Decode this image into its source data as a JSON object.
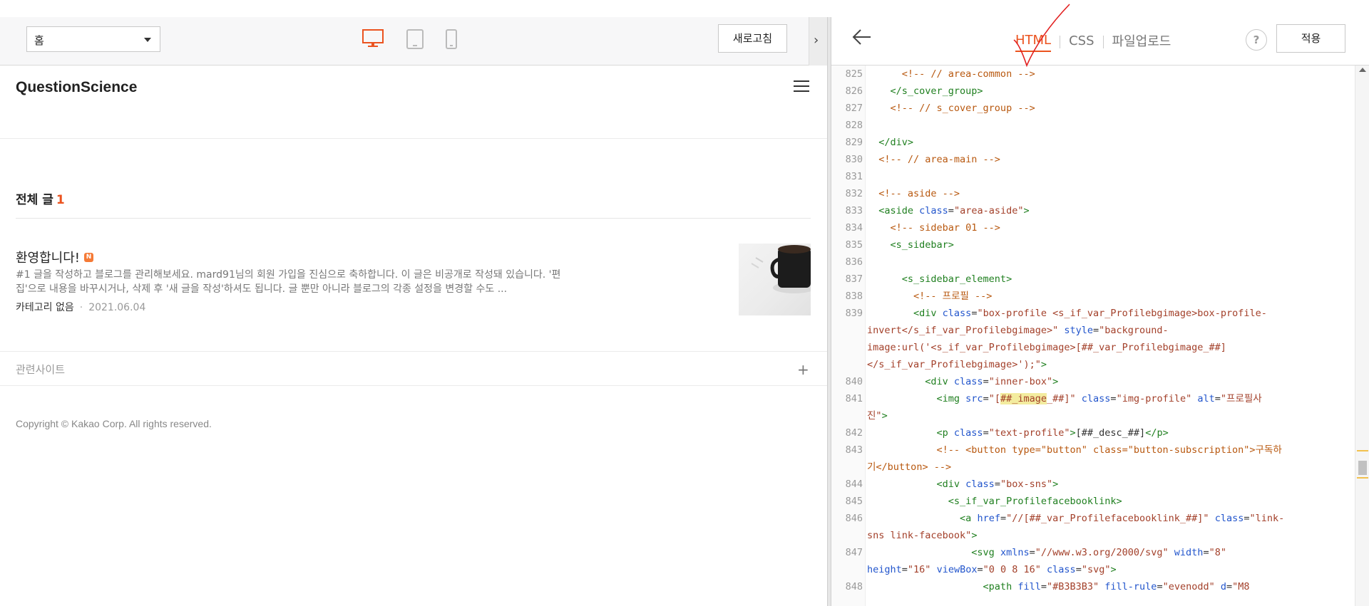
{
  "preview": {
    "page_select": {
      "value": "홈"
    },
    "refresh_label": "새로고침",
    "collapse_glyph": "›",
    "blog_title": "QuestionScience",
    "all_posts": {
      "label": "전체 글",
      "count": "1"
    },
    "post": {
      "title": "환영합니다!",
      "badge": "N",
      "excerpt": "#1 글을 작성하고 블로그를 관리해보세요. mard91님의 회원 가입을 진심으로 축하합니다. 이 글은 비공개로 작성돼 있습니다. '편집'으로 내용을 바꾸시거나, 삭제 후 '새 글을 작성'하셔도 됩니다. 글 뿐만 아니라 블로그의 각종 설정을 변경할 수도 ...",
      "category": "카테고리 없음",
      "date": "2021.06.04"
    },
    "related_sites_label": "관련사이트",
    "copyright": "Copyright © Kakao Corp. All rights reserved."
  },
  "editor": {
    "tabs": [
      {
        "label": "HTML",
        "active": true
      },
      {
        "label": "CSS",
        "active": false
      },
      {
        "label": "파일업로드",
        "active": false
      }
    ],
    "help_label": "?",
    "apply_label": "적용",
    "accent_color": "#eb531f",
    "code_lines": [
      {
        "n": "825",
        "text": ""
      },
      {
        "n": "826",
        "text": ""
      },
      {
        "n": "827",
        "text": ""
      },
      {
        "n": "828",
        "text": ""
      },
      {
        "n": "829",
        "text": ""
      },
      {
        "n": "830",
        "text": ""
      },
      {
        "n": "831",
        "text": ""
      },
      {
        "n": "832",
        "text": ""
      },
      {
        "n": "833",
        "text": ""
      },
      {
        "n": "834",
        "text": ""
      },
      {
        "n": "835",
        "text": ""
      },
      {
        "n": "836",
        "text": ""
      },
      {
        "n": "837",
        "text": ""
      },
      {
        "n": "838",
        "text": ""
      },
      {
        "n": "839",
        "text": ""
      },
      {
        "n": "840",
        "text": ""
      },
      {
        "n": "841",
        "text": ""
      },
      {
        "n": "842",
        "text": ""
      },
      {
        "n": "843",
        "text": ""
      },
      {
        "n": "844",
        "text": ""
      },
      {
        "n": "845",
        "text": ""
      },
      {
        "n": "846",
        "text": ""
      },
      {
        "n": "847",
        "text": ""
      },
      {
        "n": "848",
        "text": ""
      }
    ],
    "code_text": [
      {
        "spans": [
          [
            "c-comment",
            "      <!-- // area-common -->"
          ]
        ]
      },
      {
        "spans": [
          [
            "c-tag",
            "    </s_cover_group>"
          ]
        ]
      },
      {
        "spans": [
          [
            "c-comment",
            "    <!-- // s_cover_group -->"
          ]
        ]
      },
      {
        "spans": []
      },
      {
        "spans": [
          [
            "c-tag",
            "  </div>"
          ]
        ]
      },
      {
        "spans": [
          [
            "c-comment",
            "  <!-- // area-main -->"
          ]
        ]
      },
      {
        "spans": []
      },
      {
        "spans": [
          [
            "c-comment",
            "  <!-- aside -->"
          ]
        ]
      },
      {
        "spans": [
          [
            "c-tag",
            "  <aside "
          ],
          [
            "c-attr",
            "class"
          ],
          [
            "c-plain",
            "="
          ],
          [
            "c-str",
            "\"area-aside\""
          ],
          [
            "c-tag",
            ">"
          ]
        ]
      },
      {
        "spans": [
          [
            "c-comment",
            "    <!-- sidebar 01 -->"
          ]
        ]
      },
      {
        "spans": [
          [
            "c-tag",
            "    <s_sidebar>"
          ]
        ]
      },
      {
        "spans": []
      },
      {
        "spans": [
          [
            "c-tag",
            "      <s_sidebar_element>"
          ]
        ]
      },
      {
        "spans": [
          [
            "c-comment",
            "        <!-- 프로필 -->"
          ]
        ]
      },
      {
        "spans": [
          [
            "c-tag",
            "        <div "
          ],
          [
            "c-attr",
            "class"
          ],
          [
            "c-plain",
            "="
          ],
          [
            "c-str",
            "\"box-profile <s_if_var_Profilebgimage>box-profile-"
          ]
        ]
      },
      {
        "spans": [
          [
            "c-str",
            "invert</s_if_var_Profilebgimage>\""
          ],
          [
            "c-plain",
            " "
          ],
          [
            "c-attr",
            "style"
          ],
          [
            "c-plain",
            "="
          ],
          [
            "c-str",
            "\"background-"
          ]
        ]
      },
      {
        "spans": [
          [
            "c-str",
            "image:url('<s_if_var_Profilebgimage>[##_var_Profilebgimage_##]"
          ]
        ]
      },
      {
        "spans": [
          [
            "c-str",
            "</s_if_var_Profilebgimage>');\""
          ],
          [
            "c-tag",
            ">"
          ]
        ]
      },
      {
        "spans": [
          [
            "c-tag",
            "          <div "
          ],
          [
            "c-attr",
            "class"
          ],
          [
            "c-plain",
            "="
          ],
          [
            "c-str",
            "\"inner-box\""
          ],
          [
            "c-tag",
            ">"
          ]
        ]
      },
      {
        "spans": [
          [
            "c-tag",
            "            <img "
          ],
          [
            "c-attr",
            "src"
          ],
          [
            "c-plain",
            "="
          ],
          [
            "c-str",
            "\"["
          ],
          [
            "c-hl c-str",
            "##_image"
          ],
          [
            "c-str",
            "_##]\""
          ],
          [
            "c-plain",
            " "
          ],
          [
            "c-attr",
            "class"
          ],
          [
            "c-plain",
            "="
          ],
          [
            "c-str",
            "\"img-profile\""
          ],
          [
            "c-plain",
            " "
          ],
          [
            "c-attr",
            "alt"
          ],
          [
            "c-plain",
            "="
          ],
          [
            "c-str",
            "\"프로필사"
          ]
        ]
      },
      {
        "spans": [
          [
            "c-str",
            "진\""
          ],
          [
            "c-tag",
            ">"
          ]
        ]
      },
      {
        "spans": [
          [
            "c-tag",
            "            <p "
          ],
          [
            "c-attr",
            "class"
          ],
          [
            "c-plain",
            "="
          ],
          [
            "c-str",
            "\"text-profile\""
          ],
          [
            "c-tag",
            ">"
          ],
          [
            "c-plain",
            "[##_desc_##]"
          ],
          [
            "c-tag",
            "</p>"
          ]
        ]
      },
      {
        "spans": [
          [
            "c-comment",
            "            <!-- <button type=\"button\" class=\"button-subscription\">구독하"
          ]
        ]
      },
      {
        "spans": [
          [
            "c-comment",
            "기</button> -->"
          ]
        ]
      },
      {
        "spans": [
          [
            "c-tag",
            "            <div "
          ],
          [
            "c-attr",
            "class"
          ],
          [
            "c-plain",
            "="
          ],
          [
            "c-str",
            "\"box-sns\""
          ],
          [
            "c-tag",
            ">"
          ]
        ]
      },
      {
        "spans": [
          [
            "c-tag",
            "              <s_if_var_Profilefacebooklink>"
          ]
        ]
      },
      {
        "spans": [
          [
            "c-tag",
            "                <a "
          ],
          [
            "c-attr",
            "href"
          ],
          [
            "c-plain",
            "="
          ],
          [
            "c-str",
            "\"//[##_var_Profilefacebooklink_##]\""
          ],
          [
            "c-plain",
            " "
          ],
          [
            "c-attr",
            "class"
          ],
          [
            "c-plain",
            "="
          ],
          [
            "c-str",
            "\"link-"
          ]
        ]
      },
      {
        "spans": [
          [
            "c-str",
            "sns link-facebook\""
          ],
          [
            "c-tag",
            ">"
          ]
        ]
      },
      {
        "spans": [
          [
            "c-tag",
            "                  <svg "
          ],
          [
            "c-attr",
            "xmlns"
          ],
          [
            "c-plain",
            "="
          ],
          [
            "c-str",
            "\"//www.w3.org/2000/svg\""
          ],
          [
            "c-plain",
            " "
          ],
          [
            "c-attr",
            "width"
          ],
          [
            "c-plain",
            "="
          ],
          [
            "c-str",
            "\"8\""
          ]
        ]
      },
      {
        "spans": [
          [
            "c-attr",
            "height"
          ],
          [
            "c-plain",
            "="
          ],
          [
            "c-str",
            "\"16\""
          ],
          [
            "c-plain",
            " "
          ],
          [
            "c-attr",
            "viewBox"
          ],
          [
            "c-plain",
            "="
          ],
          [
            "c-str",
            "\"0 0 8 16\""
          ],
          [
            "c-plain",
            " "
          ],
          [
            "c-attr",
            "class"
          ],
          [
            "c-plain",
            "="
          ],
          [
            "c-str",
            "\"svg\""
          ],
          [
            "c-tag",
            ">"
          ]
        ]
      },
      {
        "spans": [
          [
            "c-tag",
            "                    <path "
          ],
          [
            "c-attr",
            "fill"
          ],
          [
            "c-plain",
            "="
          ],
          [
            "c-str",
            "\"#B3B3B3\""
          ],
          [
            "c-plain",
            " "
          ],
          [
            "c-attr",
            "fill-rule"
          ],
          [
            "c-plain",
            "="
          ],
          [
            "c-str",
            "\"evenodd\""
          ],
          [
            "c-plain",
            " "
          ],
          [
            "c-attr",
            "d"
          ],
          [
            "c-plain",
            "="
          ],
          [
            "c-str",
            "\"M8"
          ]
        ]
      }
    ]
  }
}
